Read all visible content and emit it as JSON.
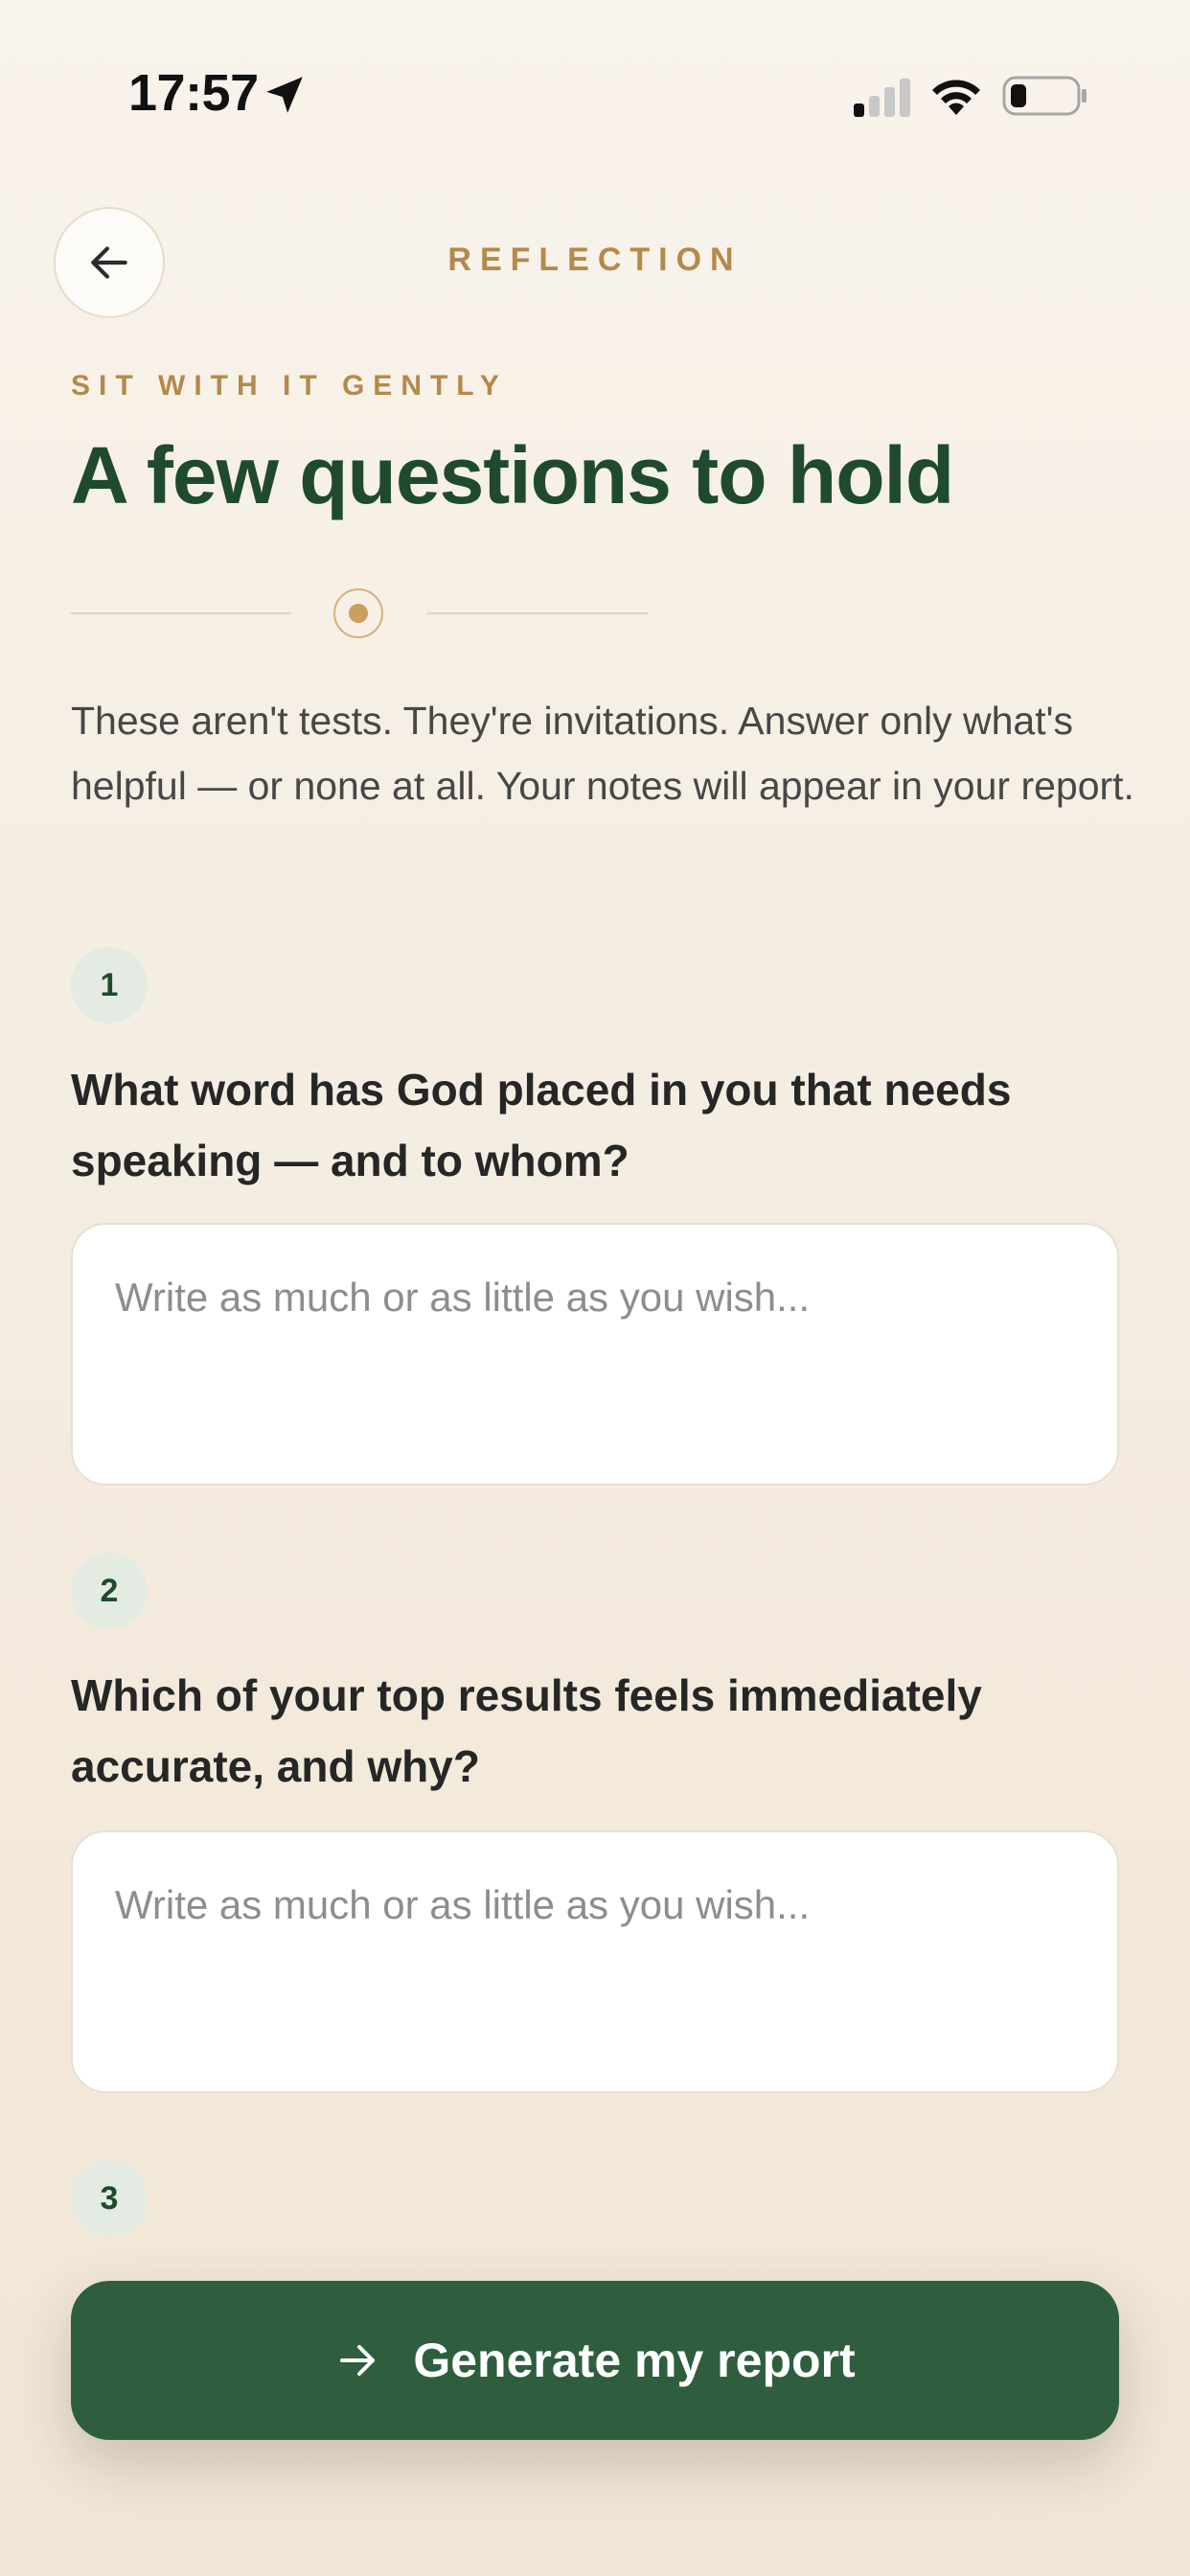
{
  "status_bar": {
    "time": "17:57",
    "icons": [
      "location-arrow-icon",
      "signal-icon",
      "wifi-icon",
      "battery-icon"
    ]
  },
  "header": {
    "back_icon": "arrow-left-icon",
    "title": "REFLECTION"
  },
  "eyebrow": "SIT WITH IT GENTLY",
  "page_title": "A few questions to hold",
  "intro": "These aren't tests. They're invitations. Answer only what's helpful — or none at all. Your notes will appear in your report.",
  "questions": [
    {
      "number": "1",
      "text": "What word has God placed in you that needs speaking — and to whom?",
      "placeholder": "Write as much or as little as you wish...",
      "value": ""
    },
    {
      "number": "2",
      "text": "Which of your top results feels immediately accurate, and why?",
      "placeholder": "Write as much or as little as you wish...",
      "value": ""
    },
    {
      "number": "3"
    }
  ],
  "cta": {
    "icon": "arrow-right-icon",
    "label": "Generate my report"
  },
  "colors": {
    "accent_gold": "#b38a4a",
    "primary_green": "#2e5e3e",
    "title_green": "#1f4a2d",
    "badge_bg": "#e3ebe2"
  }
}
